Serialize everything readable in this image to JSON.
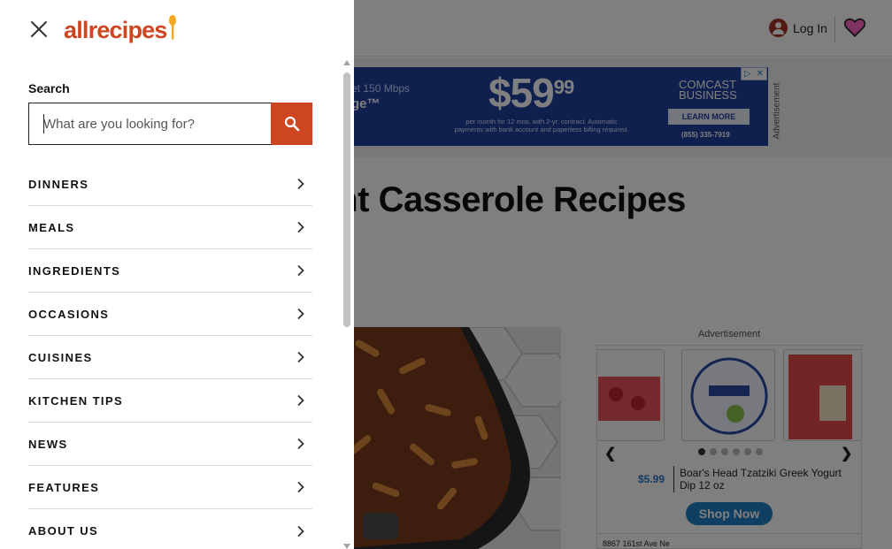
{
  "header": {
    "login_label": "Log In"
  },
  "ad_banner": {
    "speed_text": "et 150 Mbps",
    "product_text": "ge™",
    "price_main": "$59",
    "price_cents": "99",
    "fine_print": "per month for 12 mos. with 2-yr. contract. Automatic payments with bank account and paperless billing required.",
    "brand_line1": "COMCAST",
    "brand_line2": "BUSINESS",
    "cta": "LEARN MORE",
    "phone": "(855) 335-7919",
    "side_label": "Advertisement"
  },
  "article": {
    "headline": "knight Casserole Recipes"
  },
  "shop_ad": {
    "label": "Advertisement",
    "price": "$5.99",
    "product_name": "Boar's Head Tzatziki Greek Yogurt Dip 12 oz",
    "button": "Shop Now",
    "address": "8867 161st Ave Ne"
  },
  "drawer": {
    "brand": "allrecipes",
    "search": {
      "label": "Search",
      "placeholder": "What are you looking for?",
      "value": ""
    },
    "nav_items": [
      {
        "label": "DINNERS"
      },
      {
        "label": "MEALS"
      },
      {
        "label": "INGREDIENTS"
      },
      {
        "label": "OCCASIONS"
      },
      {
        "label": "CUISINES"
      },
      {
        "label": "KITCHEN TIPS"
      },
      {
        "label": "NEWS"
      },
      {
        "label": "FEATURES"
      },
      {
        "label": "ABOUT US"
      }
    ]
  },
  "colors": {
    "brand_orange": "#ce4620",
    "overlay": "rgba(0,0,0,0.5)",
    "heart_pink": "#ff66c4"
  },
  "icons": {
    "close": "close-icon",
    "search": "search-icon",
    "chevron": "chevron-right-icon",
    "user": "user-icon",
    "heart": "heart-icon",
    "spoon": "spoon-icon"
  }
}
